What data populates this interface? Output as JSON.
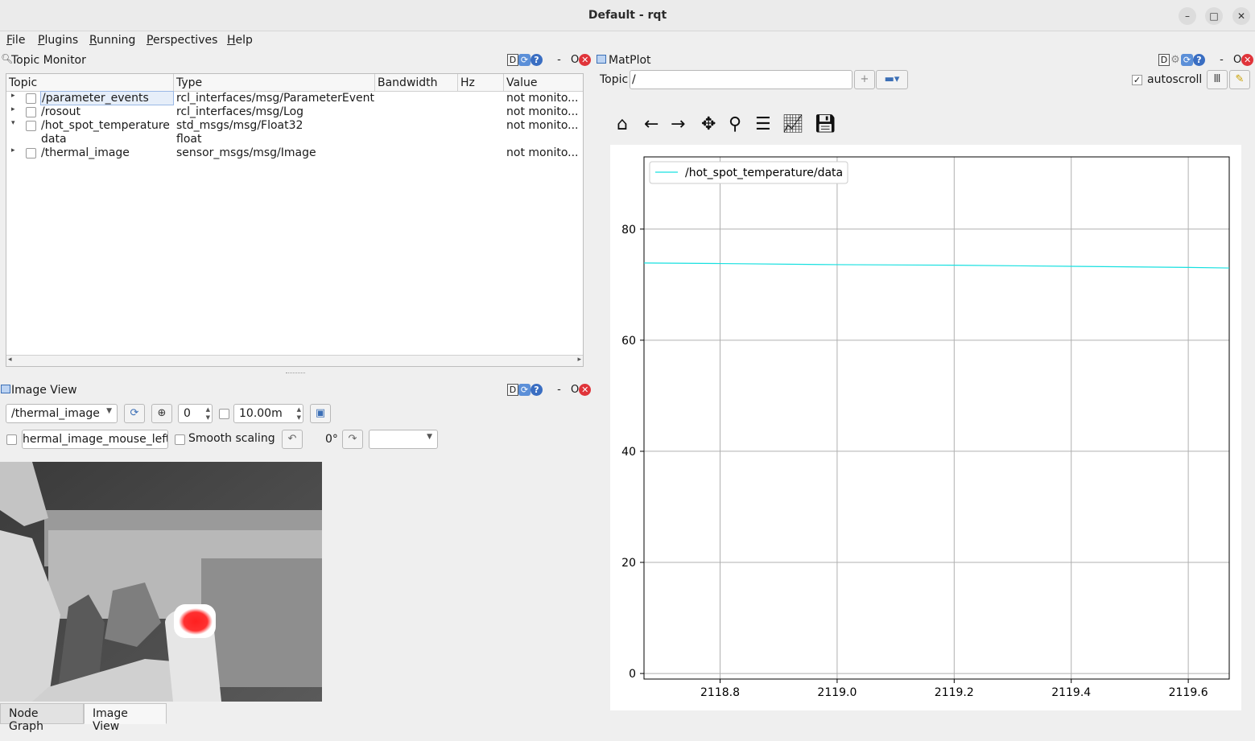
{
  "window": {
    "title": "Default - rqt",
    "controls": {
      "minimize": "–",
      "maximize": "□",
      "close": "✕"
    }
  },
  "menu": [
    "File",
    "Plugins",
    "Running",
    "Perspectives",
    "Help"
  ],
  "dock_controls": {
    "d": "D",
    "help": "?",
    "dash": "-",
    "o": "O",
    "close": "✕"
  },
  "topic_monitor": {
    "title": "Topic Monitor",
    "columns": [
      "Topic",
      "Type",
      "Bandwidth",
      "Hz",
      "Value"
    ],
    "rows": [
      {
        "arrow": "▸",
        "topic": "/parameter_events",
        "type": "rcl_interfaces/msg/ParameterEvent",
        "bandwidth": "",
        "hz": "",
        "value": "not monito..."
      },
      {
        "arrow": "▸",
        "topic": "/rosout",
        "type": "rcl_interfaces/msg/Log",
        "bandwidth": "",
        "hz": "",
        "value": "not monito..."
      },
      {
        "arrow": "▾",
        "topic": "/hot_spot_temperature",
        "type": "std_msgs/msg/Float32",
        "bandwidth": "",
        "hz": "",
        "value": "not monito..."
      },
      {
        "arrow": "",
        "topic": "data",
        "type": "float",
        "bandwidth": "",
        "hz": "",
        "value": ""
      },
      {
        "arrow": "▸",
        "topic": "/thermal_image",
        "type": "sensor_msgs/msg/Image",
        "bandwidth": "",
        "hz": "",
        "value": "not monito..."
      }
    ]
  },
  "image_view": {
    "title": "Image View",
    "topic": "/thermal_image",
    "spin_value": "0",
    "max_age": "10.00m",
    "mouse_topic": "hermal_image_mouse_left",
    "smooth_scaling_label": "Smooth scaling",
    "rotation": "0°",
    "color_scheme": ""
  },
  "tabs": [
    "Node Graph",
    "Image View"
  ],
  "matplot": {
    "title": "MatPlot",
    "topic_label": "Topic",
    "topic_value": "/",
    "autoscroll_label": "autoscroll",
    "autoscroll_checked": true,
    "toolbar": [
      "home-icon",
      "back-icon",
      "forward-icon",
      "pan-icon",
      "zoom-icon",
      "configure-icon",
      "edit-axis-icon",
      "save-icon"
    ]
  },
  "chart_data": {
    "type": "line",
    "title": "",
    "xlabel": "",
    "ylabel": "",
    "xlim": [
      2118.67,
      2119.67
    ],
    "ylim": [
      -1,
      93
    ],
    "xticks": [
      2118.8,
      2119.0,
      2119.2,
      2119.4,
      2119.6
    ],
    "xtick_labels": [
      "2118.8",
      "2119.0",
      "2119.2",
      "2119.4",
      "2119.6"
    ],
    "yticks": [
      0,
      20,
      40,
      60,
      80
    ],
    "ytick_labels": [
      "0",
      "20",
      "40",
      "60",
      "80"
    ],
    "grid": true,
    "legend": "top-left",
    "series": [
      {
        "name": "/hot_spot_temperature/data",
        "color": "#17e0e0",
        "x": [
          2118.67,
          2118.8,
          2119.0,
          2119.2,
          2119.4,
          2119.6,
          2119.67
        ],
        "y": [
          73.9,
          73.8,
          73.6,
          73.5,
          73.3,
          73.1,
          73.0
        ]
      }
    ]
  }
}
